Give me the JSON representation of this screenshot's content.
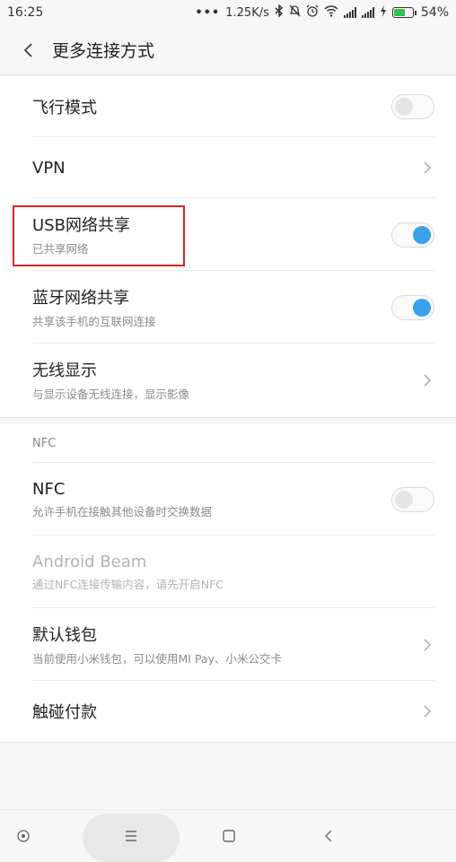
{
  "status_bar": {
    "time": "16:25",
    "network_speed": "1.25K/s",
    "battery_percent": "54%",
    "icons": [
      "more-dots-icon",
      "bluetooth-icon",
      "mute-icon",
      "alarm-icon",
      "wifi-icon",
      "signal-icon",
      "signal-icon",
      "charging-icon",
      "battery-icon"
    ]
  },
  "header": {
    "title": "更多连接方式"
  },
  "section1": {
    "items": [
      {
        "title": "飞行模式",
        "control": "toggle",
        "state": "off"
      },
      {
        "title": "VPN",
        "control": "chevron"
      },
      {
        "title": "USB网络共享",
        "subtitle": "已共享网络",
        "control": "toggle",
        "state": "on"
      },
      {
        "title": "蓝牙网络共享",
        "subtitle": "共享该手机的互联网连接",
        "control": "toggle",
        "state": "on"
      },
      {
        "title": "无线显示",
        "subtitle": "与显示设备无线连接，显示影像",
        "control": "chevron"
      }
    ]
  },
  "nfc_group_label": "NFC",
  "section2": {
    "items": [
      {
        "title": "NFC",
        "subtitle": "允许手机在接触其他设备时交换数据",
        "control": "toggle",
        "state": "off"
      },
      {
        "title": "Android Beam",
        "subtitle": "通过NFC连接传输内容，请先开启NFC",
        "control": "none",
        "disabled": true
      },
      {
        "title": "默认钱包",
        "subtitle": "当前使用小米钱包，可以使用MI Pay、小米公交卡",
        "control": "chevron"
      },
      {
        "title": "触碰付款",
        "control": "chevron"
      }
    ]
  },
  "colors": {
    "accent": "#3ba0ec",
    "highlight_border": "#d9252a",
    "battery_fill": "#31c24e"
  },
  "nav_bar": {
    "buttons": [
      "home-dot-icon",
      "menu-icon",
      "square-icon",
      "back-triangle-icon"
    ]
  }
}
